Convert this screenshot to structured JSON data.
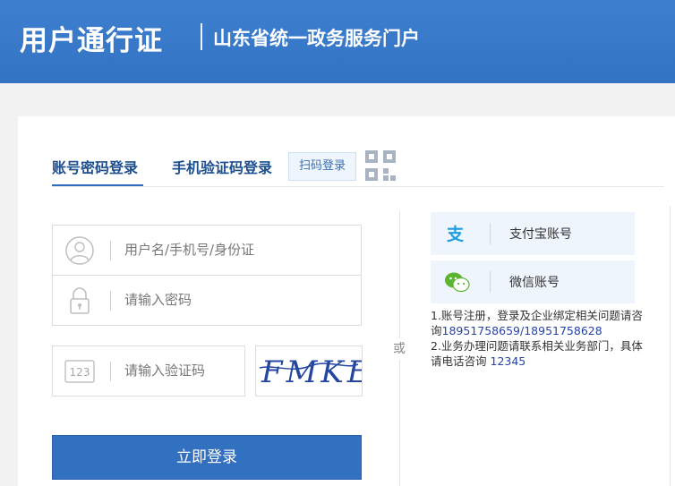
{
  "header": {
    "title": "用户通行证",
    "subtitle": "山东省统一政务服务门户"
  },
  "tabs": {
    "account": "账号密码登录",
    "phone": "手机验证码登录",
    "qr": "扫码登录"
  },
  "form": {
    "username_placeholder": "用户名/手机号/身份证",
    "password_placeholder": "请输入密码",
    "code_placeholder": "请输入验证码",
    "code_icon_text": "123",
    "captcha_text": "FMKE",
    "login_label": "立即登录"
  },
  "divider_text": "或",
  "third_party": {
    "alipay_label": "支付宝账号",
    "wechat_label": "微信账号"
  },
  "notes": {
    "line1_prefix": "1.账号注册，登录及企业绑定相关问题请咨询",
    "line1_phones": "18951758659/18951758628",
    "line2_prefix": "2.业务办理问题请联系相关业务部门，具体请电话咨询",
    "line2_phone": "12345"
  },
  "colors": {
    "header_blue": "#3373c3",
    "accent_blue": "#2f6bbf",
    "link_blue": "#2742a8"
  }
}
